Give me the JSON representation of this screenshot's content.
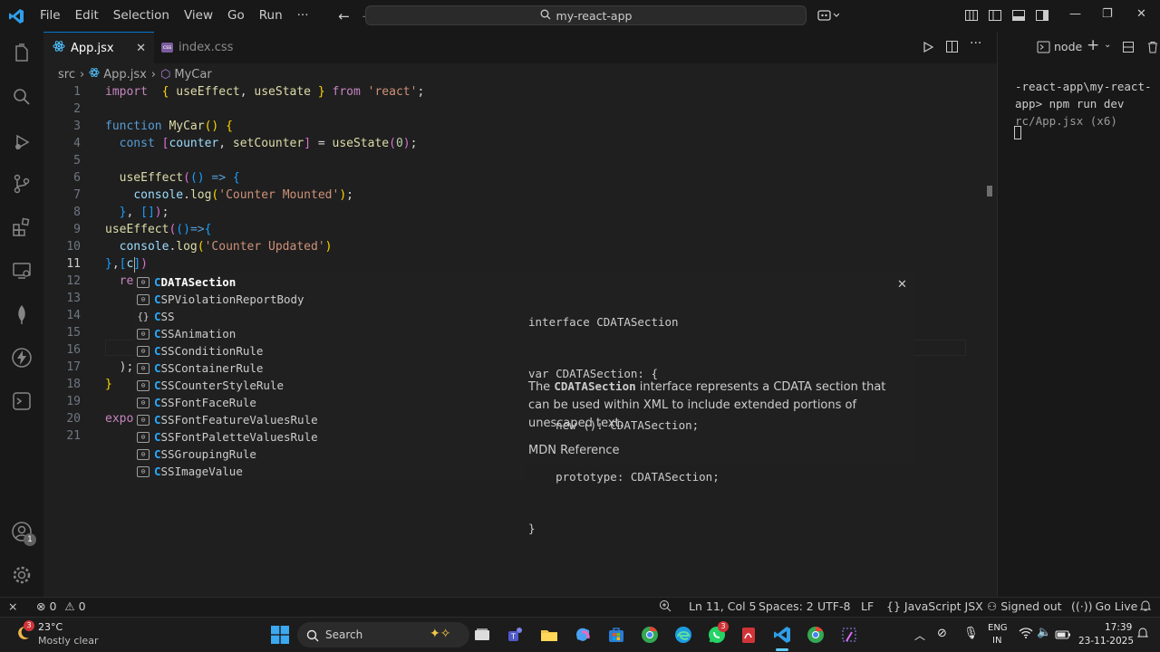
{
  "titlebar": {
    "menu": [
      "File",
      "Edit",
      "Selection",
      "View",
      "Go",
      "Run",
      "···"
    ],
    "search_text": "my-react-app"
  },
  "tabs": [
    {
      "label": "App.jsx",
      "active": true
    },
    {
      "label": "index.css",
      "active": false
    }
  ],
  "breadcrumb": {
    "folder": "src",
    "file": "App.jsx",
    "symbol": "MyCar"
  },
  "editor": {
    "line_numbers": [
      "1",
      "2",
      "3",
      "4",
      "5",
      "6",
      "7",
      "8",
      "9",
      "10",
      "11",
      "12",
      "13",
      "14",
      "15",
      "16",
      "17",
      "18",
      "19",
      "20",
      "21"
    ],
    "current_line": "11"
  },
  "suggest": {
    "items": [
      {
        "highlight": "C",
        "rest": "DATASection",
        "kind": "symbol-class"
      },
      {
        "highlight": "C",
        "rest": "SPViolationReportBody",
        "kind": "symbol-class"
      },
      {
        "highlight": "C",
        "rest": "SS",
        "kind": "symbol-namespace"
      },
      {
        "highlight": "C",
        "rest": "SSAnimation",
        "kind": "symbol-class"
      },
      {
        "highlight": "C",
        "rest": "SSConditionRule",
        "kind": "symbol-class"
      },
      {
        "highlight": "C",
        "rest": "SSContainerRule",
        "kind": "symbol-class"
      },
      {
        "highlight": "C",
        "rest": "SSCounterStyleRule",
        "kind": "symbol-class"
      },
      {
        "highlight": "C",
        "rest": "SSFontFaceRule",
        "kind": "symbol-class"
      },
      {
        "highlight": "C",
        "rest": "SSFontFeatureValuesRule",
        "kind": "symbol-class"
      },
      {
        "highlight": "C",
        "rest": "SSFontPaletteValuesRule",
        "kind": "symbol-class"
      },
      {
        "highlight": "C",
        "rest": "SSGroupingRule",
        "kind": "symbol-class"
      },
      {
        "highlight": "C",
        "rest": "SSImageValue",
        "kind": "symbol-class"
      }
    ]
  },
  "doc": {
    "code": [
      "interface CDATASection",
      "var CDATASection: {",
      "    new (): CDATASection;",
      "    prototype: CDATASection;",
      "}"
    ],
    "desc_pre": "The ",
    "desc_symbol": "CDATASection",
    "desc_post": " interface represents a CDATA section that can be used within XML to include extended portions of unescaped text.",
    "reference": "MDN Reference"
  },
  "terminal": {
    "shell": "node",
    "lines": [
      "-react-app\\my-react-",
      "app> npm run dev",
      "rc/App.jsx (x6)"
    ]
  },
  "statusbar": {
    "errors": "0",
    "warnings": "0",
    "position": "Ln 11, Col 5",
    "spaces": "Spaces: 2",
    "encoding": "UTF-8",
    "eol": "LF",
    "language": "JavaScript JSX",
    "account": "Signed out",
    "golive": "Go Live"
  },
  "taskbar": {
    "weather_temp": "23°C",
    "weather_desc": "Mostly clear",
    "weather_badge": "3",
    "search_label": "Search",
    "lang1": "ENG",
    "lang2": "IN",
    "time": "17:39",
    "date": "23-11-2025",
    "whatsapp_badge": "3"
  },
  "accounts_badge": "1",
  "colors": {
    "accent": "#0078d4",
    "suggest_highlight": "#2aaaff"
  }
}
